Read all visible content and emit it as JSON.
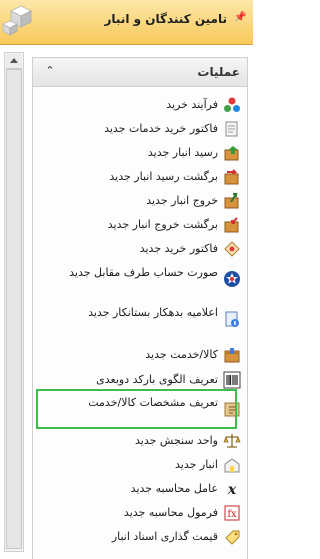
{
  "window": {
    "title": "تامین کنندگان و انبار",
    "pin_icon": "pin-icon",
    "logo_icon": "cubes-logo-icon"
  },
  "panel": {
    "header": "عملیات",
    "collapse_icon": "double-chevron-up-icon",
    "items": [
      {
        "label": "فرآیند خرید",
        "icon": "process-icon"
      },
      {
        "label": "فاکتور خرید خدمات جدید",
        "icon": "invoice-services-icon"
      },
      {
        "label": "رسید انبار جدید",
        "icon": "warehouse-receipt-icon"
      },
      {
        "label": "برگشت رسید انبار جدید",
        "icon": "return-receipt-icon"
      },
      {
        "label": "خروج انبار جدید",
        "icon": "warehouse-exit-icon"
      },
      {
        "label": "برگشت خروج انبار جدید",
        "icon": "return-exit-icon"
      },
      {
        "label": "فاکتور خرید جدید",
        "icon": "purchase-invoice-icon"
      },
      {
        "label": "صورت حساب طرف مقابل جدید",
        "icon": "counterparty-statement-icon"
      },
      {
        "label": "اعلامیه بدهکار بستانکار جدید",
        "icon": "debit-credit-notice-icon"
      },
      {
        "label": "کالا/خدمت جدید",
        "icon": "product-service-icon"
      },
      {
        "label": "تعریف الگوی بارکد دوبعدی",
        "icon": "barcode-icon"
      },
      {
        "label": "تعریف مشخصات کالا/خدمت",
        "icon": "product-specs-icon"
      },
      {
        "label": "واحد سنجش جدید",
        "icon": "scale-icon"
      },
      {
        "label": "انبار جدید",
        "icon": "warehouse-icon"
      },
      {
        "label": "عامل محاسبه جدید",
        "icon": "calculation-factor-icon"
      },
      {
        "label": "فرمول محاسبه جدید",
        "icon": "formula-icon"
      },
      {
        "label": "قیمت گذاری اسناد انبار",
        "icon": "pricing-icon"
      }
    ]
  },
  "highlight_color": "#3dbd4b"
}
